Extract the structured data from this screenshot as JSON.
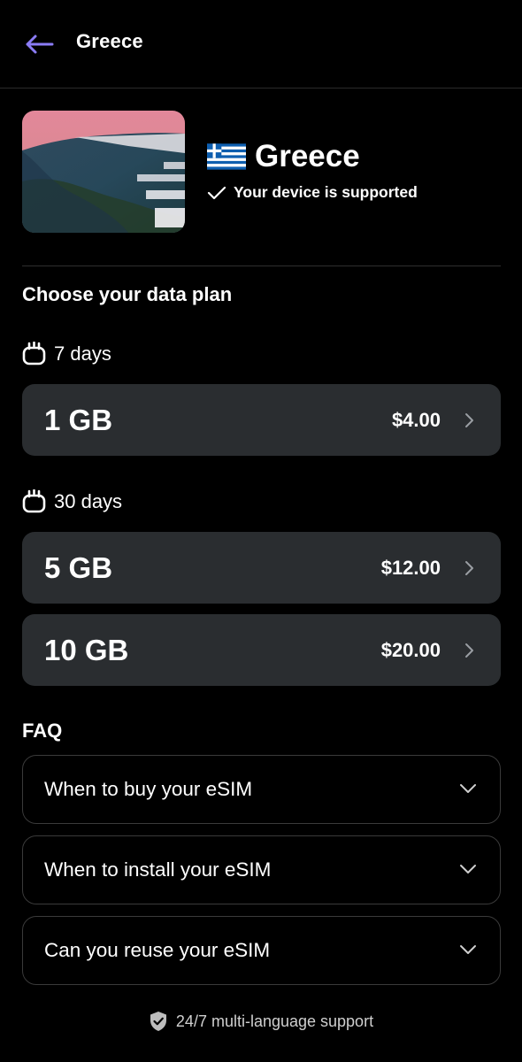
{
  "header": {
    "title": "Greece"
  },
  "hero": {
    "country_name": "Greece",
    "flag_icon": "greece-flag-icon",
    "supported_text": "Your device is supported"
  },
  "plans": {
    "section_title": "Choose your data plan",
    "groups": [
      {
        "duration": "7 days",
        "items": [
          {
            "size": "1 GB",
            "price": "$4.00"
          }
        ]
      },
      {
        "duration": "30 days",
        "items": [
          {
            "size": "5 GB",
            "price": "$12.00"
          },
          {
            "size": "10 GB",
            "price": "$20.00"
          }
        ]
      }
    ]
  },
  "faq": {
    "title": "FAQ",
    "items": [
      {
        "label": "When to buy your eSIM"
      },
      {
        "label": "When to install your eSIM"
      },
      {
        "label": "Can you reuse your eSIM"
      }
    ]
  },
  "footer": {
    "support_text": "24/7 multi-language support"
  },
  "colors": {
    "background": "#000000",
    "card": "#2a2d30",
    "accent": "#8b7cf6",
    "text": "#ffffff",
    "muted": "#cfcfcf"
  }
}
